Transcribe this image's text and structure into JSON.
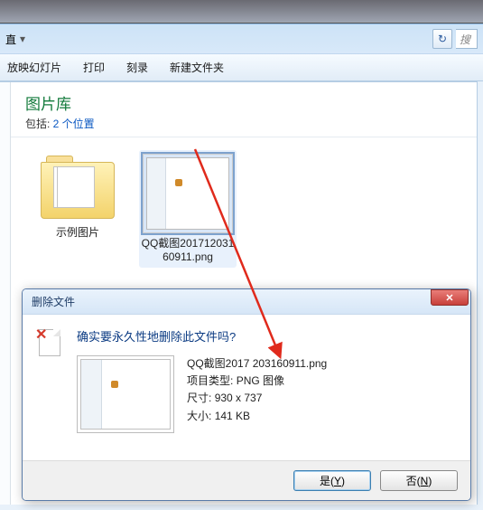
{
  "addr": {
    "refresh_icon": "↻",
    "search_placeholder": "搜"
  },
  "toolbar": {
    "menu_partial": "直",
    "slideshow": "放映幻灯片",
    "print": "打印",
    "burn": "刻录",
    "new_folder": "新建文件夹"
  },
  "library": {
    "title": "图片库",
    "sub_prefix": "包括: ",
    "sub_link": "2 个位置"
  },
  "items": [
    {
      "caption": "示例图片"
    },
    {
      "caption": "QQ截图2017120316091​1.png"
    }
  ],
  "dialog": {
    "title": "删除文件",
    "close_icon": "✕",
    "question": "确实要永久性地删除此文件吗?",
    "filename": "QQ截图2017 203160911.png",
    "type_label": "项目类型:",
    "type_value": "PNG 图像",
    "size_label": "尺寸:",
    "size_value": "930 x 737",
    "fsize_label": "大小:",
    "fsize_value": "141 KB",
    "yes_label": "是(",
    "yes_key": "Y",
    "yes_tail": ")",
    "no_label": "否(",
    "no_key": "N",
    "no_tail": ")"
  }
}
